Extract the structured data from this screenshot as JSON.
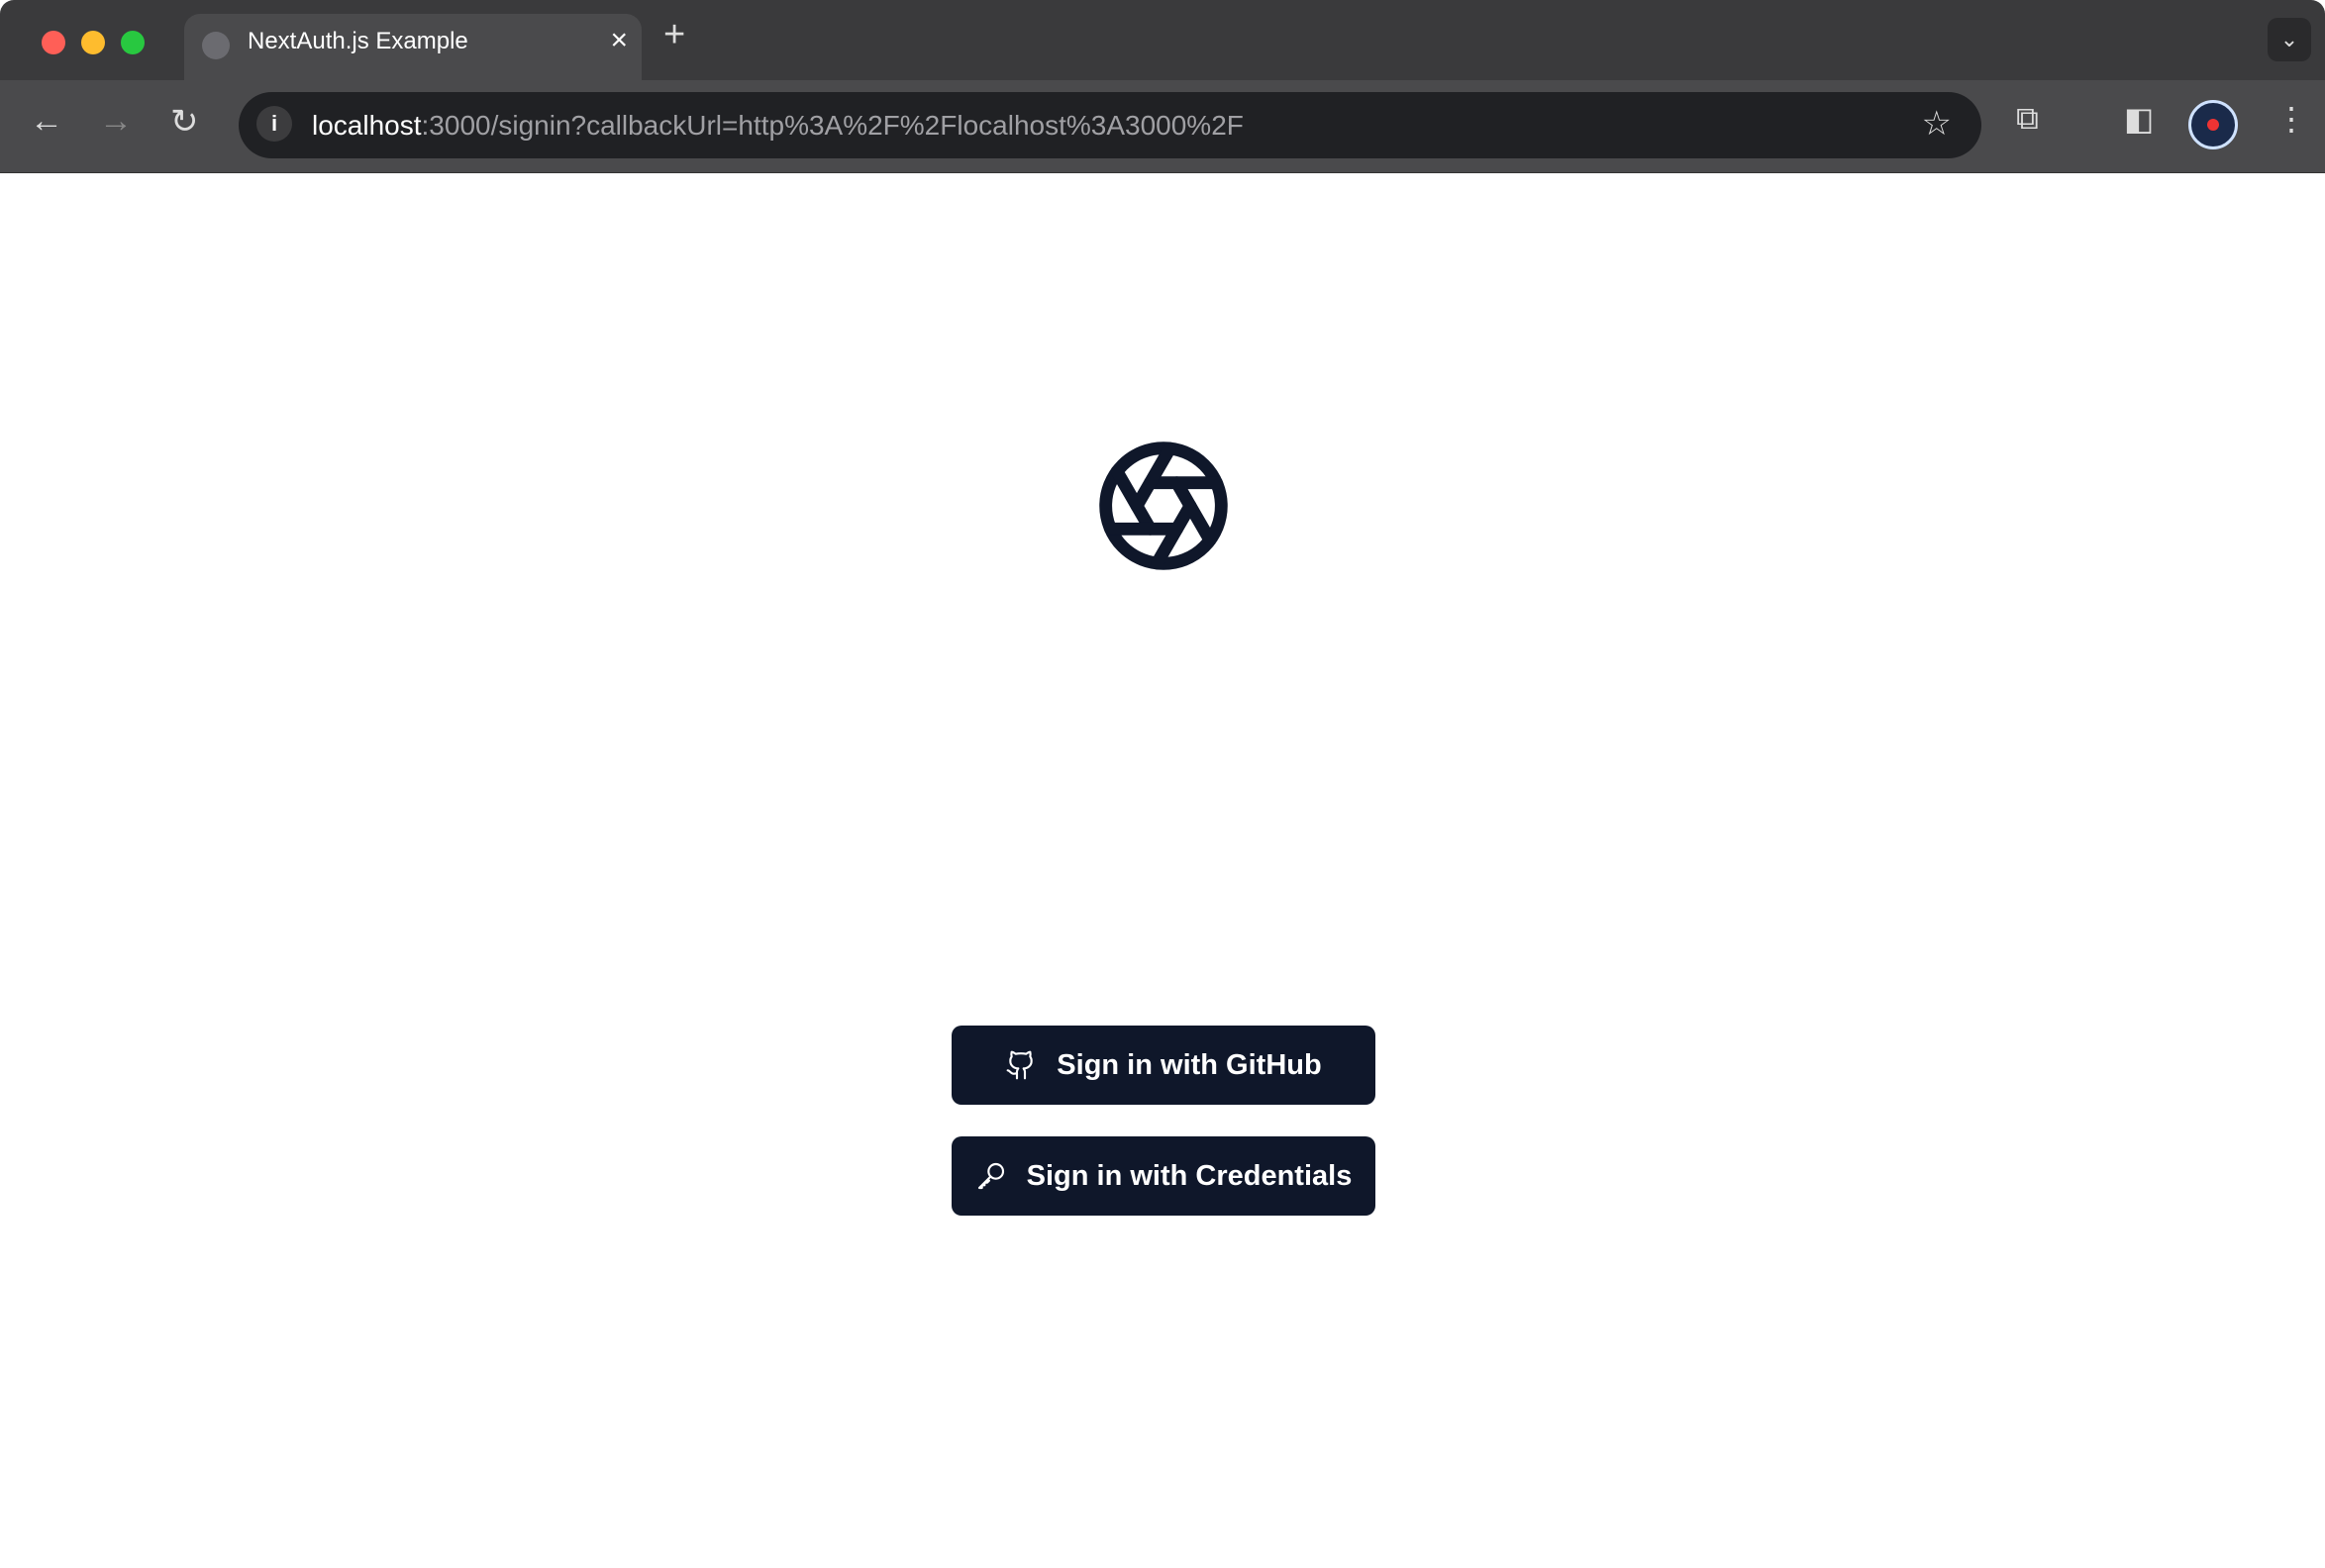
{
  "browser": {
    "tab_title": "NextAuth.js Example",
    "url_host": "localhost",
    "url_rest": ":3000/signin?callbackUrl=http%3A%2F%2Flocalhost%3A3000%2F"
  },
  "page": {
    "logo_icon": "aperture-icon",
    "buttons": [
      {
        "label": "Sign in with GitHub",
        "icon": "github-icon"
      },
      {
        "label": "Sign in with Credentials",
        "icon": "key-icon"
      }
    ]
  },
  "colors": {
    "button_bg": "#0f172a",
    "logo": "#0f172a"
  }
}
